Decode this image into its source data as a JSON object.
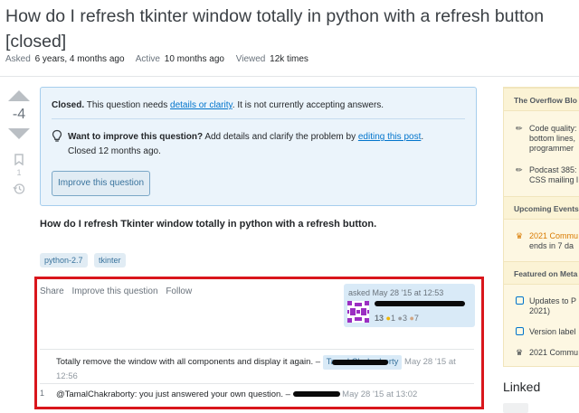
{
  "question": {
    "title": "How do I refresh tkinter window totally in python with a refresh button [closed]",
    "meta": {
      "asked_label": "Asked",
      "asked_value": "6 years, 4 months ago",
      "active_label": "Active",
      "active_value": "10 months ago",
      "viewed_label": "Viewed",
      "viewed_value": "12k times"
    },
    "score": "-4",
    "bookmark_count": "1",
    "body": "How do I refresh Tkinter window totally in python with a refresh button.",
    "tags": [
      "python-2.7",
      "tkinter"
    ]
  },
  "notice": {
    "closed_bold": "Closed.",
    "closed_pre": "This question needs",
    "closed_link": "details or clarity",
    "closed_post": ". It is not currently accepting answers.",
    "improve_bold": "Want to improve this question?",
    "improve_pre": "Add details and clarify the problem by",
    "improve_link": "editing this post",
    "improve_post": ".",
    "closed_ago": "Closed 12 months ago.",
    "improve_button": "Improve this question"
  },
  "post_menu": {
    "share": "Share",
    "improve": "Improve this question",
    "follow": "Follow"
  },
  "user_card": {
    "asked": "asked May 28 '15 at 12:53",
    "reputation": "13",
    "gold": "1",
    "silver": "3",
    "bronze": "7"
  },
  "comments": [
    {
      "score": "",
      "text": "Totally remove the window with all components and display it again. –",
      "user": "Tamal Chakraborty",
      "date": "May 28 '15 at 12:56"
    },
    {
      "score": "1",
      "text": "@TamalChakraborty: you just answered your own question. –",
      "user": "",
      "date": "May 28 '15 at 13:02"
    }
  ],
  "sidebar": {
    "blog_title": "The Overflow Blo",
    "blog_items": [
      "Code quality:",
      "bottom lines,",
      "programmer",
      "Podcast 385:",
      "CSS mailing l"
    ],
    "events_title": "Upcoming Events",
    "events_items": [
      "2021 Commu",
      "ends in 7 da"
    ],
    "meta_title": "Featured on Meta",
    "meta_items": [
      "Updates to P",
      "2021)",
      "Version label",
      "2021 Commu"
    ]
  },
  "linked_heading": "Linked",
  "colors": {
    "accent": "#0074cc",
    "notice_bg": "#ebf4fb",
    "sidebar_bg": "#fdf7e2",
    "highlight_box": "#d9161c"
  }
}
